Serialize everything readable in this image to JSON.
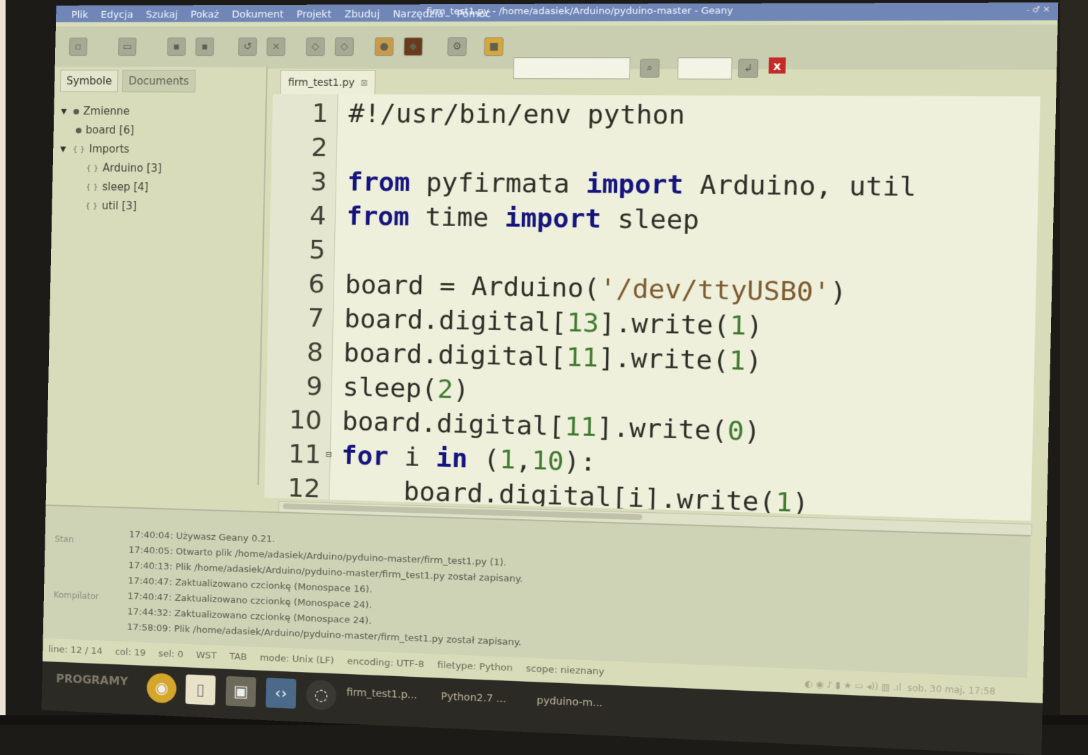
{
  "window": {
    "title": "firm_test1.py - /home/adasiek/Arduino/pyduino-master - Geany",
    "controls": "- ♂ ✕"
  },
  "menu": [
    "Plik",
    "Edycja",
    "Szukaj",
    "Pokaż",
    "Dokument",
    "Projekt",
    "Zbuduj",
    "Narzędzia",
    "Pomoc"
  ],
  "toolbar": {
    "icons": [
      "new-file-icon",
      "open-file-icon",
      "save-icon",
      "save-all-icon",
      "revert-icon",
      "close-file-icon",
      "back-icon",
      "forward-icon",
      "compile-icon",
      "build-icon",
      "settings-icon",
      "color-picker-icon",
      "search-icon",
      "goto-line-icon",
      "quit-icon"
    ],
    "close_glyph": "x"
  },
  "sidebar": {
    "tabs": [
      "Symbole",
      "Documents"
    ],
    "tree": [
      {
        "label": "Zmienne",
        "level": 0
      },
      {
        "label": "board [6]",
        "level": 1
      },
      {
        "label": "Imports",
        "level": 0
      },
      {
        "label": "Arduino [3]",
        "level": 1
      },
      {
        "label": "sleep [4]",
        "level": 1
      },
      {
        "label": "util [3]",
        "level": 1
      }
    ]
  },
  "editor": {
    "file_tab": "firm_test1.py",
    "lines": [
      {
        "n": "1",
        "text": "#!/usr/bin/env python"
      },
      {
        "n": "2",
        "text": ""
      },
      {
        "n": "3",
        "text": "from pyfirmata import Arduino, util"
      },
      {
        "n": "4",
        "text": "from time import sleep"
      },
      {
        "n": "5",
        "text": ""
      },
      {
        "n": "6",
        "text": "board = Arduino('/dev/ttyUSB0')"
      },
      {
        "n": "7",
        "text": "board.digital[13].write(1)"
      },
      {
        "n": "8",
        "text": "board.digital[11].write(1)"
      },
      {
        "n": "9",
        "text": "sleep(2)"
      },
      {
        "n": "10",
        "text": "board.digital[11].write(0)"
      },
      {
        "n": "11",
        "text": "for i in (1,10):"
      },
      {
        "n": "12",
        "text": "    board.digital[i].write(1)"
      }
    ]
  },
  "messages": [
    "17:40:04: Używasz Geany 0.21.",
    "17:40:05: Otwarto plik /home/adasiek/Arduino/pyduino-master/firm_test1.py (1).",
    "17:40:13: Plik /home/adasiek/Arduino/pyduino-master/firm_test1.py został zapisany.",
    "17:40:47: Zaktualizowano czcionkę (Monospace 16).",
    "17:40:47: Zaktualizowano czcionkę (Monospace 24).",
    "17:44:32: Zaktualizowano czcionkę (Monospace 24).",
    "17:58:09: Plik /home/adasiek/Arduino/pyduino-master/firm_test1.py został zapisany."
  ],
  "message_panel_side": [
    "Stan",
    "Kompilator"
  ],
  "statusbar": [
    "line: 12 / 14",
    "col: 19",
    "sel: 0",
    "WST",
    "TAB",
    "mode: Unix (LF)",
    "encoding: UTF-8",
    "filetype: Python",
    "scope: nieznany"
  ],
  "taskbar": {
    "programs_label": "PROGRAMY",
    "windows": [
      "firm_test1.p...",
      "Python2.7 ...",
      "pyduino-m..."
    ],
    "clock": "sob, 30 maj, 17:58"
  }
}
